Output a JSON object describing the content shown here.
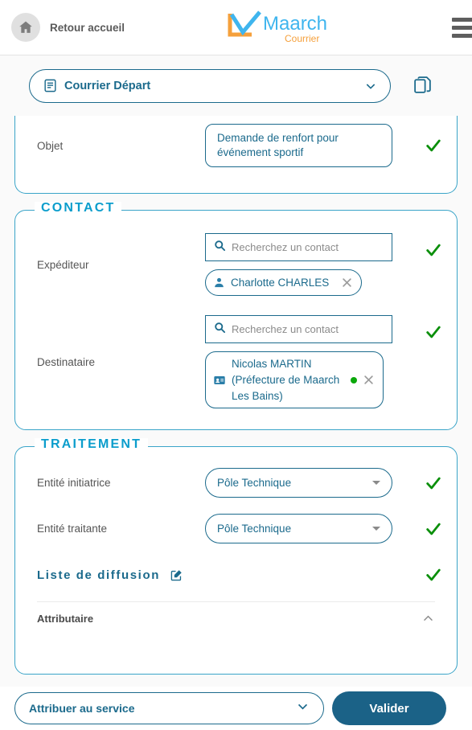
{
  "header": {
    "home_label": "Retour accueil",
    "home_icon": "home-icon",
    "logo_main": "Maarch",
    "logo_sub": "Courrier",
    "menu_icon": "hamburger-menu-icon"
  },
  "subheader": {
    "doctype_value": "Courrier Départ",
    "doctype_icon": "document-type-icon",
    "chevron_icon": "chevron-down-icon",
    "copy_icon": "copy-documents-icon"
  },
  "sections": {
    "objet": {
      "label": "Objet",
      "value": "Demande de renfort pour événement sportif",
      "valid_icon": "green-check-icon"
    },
    "contact": {
      "legend": "CONTACT",
      "expediteur": {
        "label": "Expéditeur",
        "search_placeholder": "Recherchez un contact",
        "search_icon": "search-icon",
        "valid_icon": "green-check-icon",
        "chip": {
          "name": "Charlotte CHARLES",
          "icon": "person-icon",
          "close_icon": "close-icon"
        }
      },
      "destinataire": {
        "label": "Destinataire",
        "search_placeholder": "Recherchez un contact",
        "search_icon": "search-icon",
        "valid_icon": "green-check-icon",
        "chip": {
          "name": "Nicolas MARTIN (Préfecture de Maarch Les Bains)",
          "icon": "contact-card-icon",
          "status_dot": "#0ba80b",
          "close_icon": "close-icon"
        }
      }
    },
    "traitement": {
      "legend": "TRAITEMENT",
      "entite_initiatrice": {
        "label": "Entité initiatrice",
        "value": "Pôle Technique",
        "caret_icon": "dropdown-caret-icon",
        "valid_icon": "green-check-icon"
      },
      "entite_traitante": {
        "label": "Entité traitante",
        "value": "Pôle Technique",
        "caret_icon": "dropdown-caret-icon",
        "valid_icon": "green-check-icon"
      },
      "diffusion": {
        "title": "Liste de diffusion",
        "edit_icon": "edit-icon",
        "valid_icon": "green-check-icon",
        "attributaire": {
          "label": "Attributaire",
          "chevron_icon": "chevron-up-icon"
        }
      }
    }
  },
  "footer": {
    "assign_value": "Attribuer au service",
    "assign_chevron": "chevron-down-icon",
    "validate_label": "Valider"
  },
  "colors": {
    "brand_teal": "#1b6a8c",
    "legend_cyan": "#0b9dcc",
    "valid_green": "#0ba80b",
    "button_blue": "#1b6287",
    "logo_orange": "#f5a03c",
    "logo_blue": "#3fb5ee"
  }
}
